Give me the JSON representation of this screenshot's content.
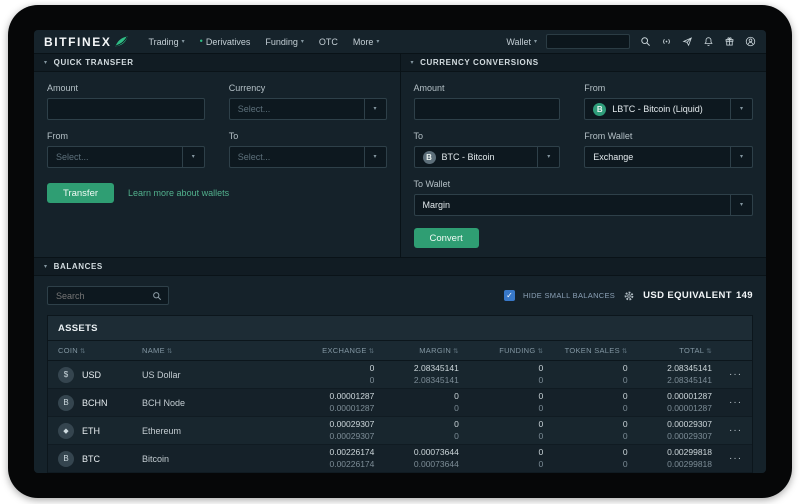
{
  "colors": {
    "accent_green": "#2f9e73",
    "link_green": "#52b18d",
    "checkbox_blue": "#3878c8",
    "panel_bg": "#15222a",
    "screen_bg": "#0d171d"
  },
  "navbar": {
    "brand": "BITFINEX",
    "items": [
      {
        "label": "Trading"
      },
      {
        "label": "Derivatives"
      },
      {
        "label": "Funding"
      },
      {
        "label": "OTC"
      },
      {
        "label": "More"
      }
    ],
    "wallet": "Wallet",
    "search_value": ""
  },
  "quick_transfer": {
    "title": "QUICK TRANSFER",
    "amount_label": "Amount",
    "currency_label": "Currency",
    "currency_placeholder": "Select...",
    "from_label": "From",
    "from_placeholder": "Select...",
    "to_label": "To",
    "to_placeholder": "Select...",
    "transfer_button": "Transfer",
    "learn_link": "Learn more about wallets"
  },
  "currency_conversions": {
    "title": "CURRENCY CONVERSIONS",
    "amount_label": "Amount",
    "from_label": "From",
    "from_value": "LBTC - Bitcoin (Liquid)",
    "from_symbol": "B",
    "to_label": "To",
    "to_value": "BTC - Bitcoin",
    "to_symbol": "B",
    "from_wallet_label": "From Wallet",
    "from_wallet_value": "Exchange",
    "to_wallet_label": "To Wallet",
    "to_wallet_value": "Margin",
    "convert_button": "Convert"
  },
  "balances": {
    "title": "BALANCES",
    "search_placeholder": "Search",
    "hide_small_label": "HIDE SMALL BALANCES",
    "usd_equivalent_label": "USD EQUIVALENT",
    "usd_equivalent_value": "149",
    "table": {
      "section_header": "ASSETS",
      "columns": [
        "COIN",
        "NAME",
        "EXCHANGE",
        "MARGIN",
        "FUNDING",
        "TOKEN SALES",
        "TOTAL"
      ],
      "rows": [
        {
          "coin": "USD",
          "symbol": "$",
          "name": "US Dollar",
          "exchange": [
            "0",
            "0"
          ],
          "margin": [
            "2.08345141",
            "2.08345141"
          ],
          "funding": [
            "0",
            "0"
          ],
          "token_sales": [
            "0",
            "0"
          ],
          "total": [
            "2.08345141",
            "2.08345141"
          ]
        },
        {
          "coin": "BCHN",
          "symbol": "B",
          "name": "BCH Node",
          "exchange": [
            "0.00001287",
            "0.00001287"
          ],
          "margin": [
            "0",
            "0"
          ],
          "funding": [
            "0",
            "0"
          ],
          "token_sales": [
            "0",
            "0"
          ],
          "total": [
            "0.00001287",
            "0.00001287"
          ]
        },
        {
          "coin": "ETH",
          "symbol": "◆",
          "name": "Ethereum",
          "exchange": [
            "0.00029307",
            "0.00029307"
          ],
          "margin": [
            "0",
            "0"
          ],
          "funding": [
            "0",
            "0"
          ],
          "token_sales": [
            "0",
            "0"
          ],
          "total": [
            "0.00029307",
            "0.00029307"
          ]
        },
        {
          "coin": "BTC",
          "symbol": "B",
          "name": "Bitcoin",
          "exchange": [
            "0.00226174",
            "0.00226174"
          ],
          "margin": [
            "0.00073644",
            "0.00073644"
          ],
          "funding": [
            "0",
            "0"
          ],
          "token_sales": [
            "0",
            "0"
          ],
          "total": [
            "0.00299818",
            "0.00299818"
          ]
        }
      ]
    }
  }
}
